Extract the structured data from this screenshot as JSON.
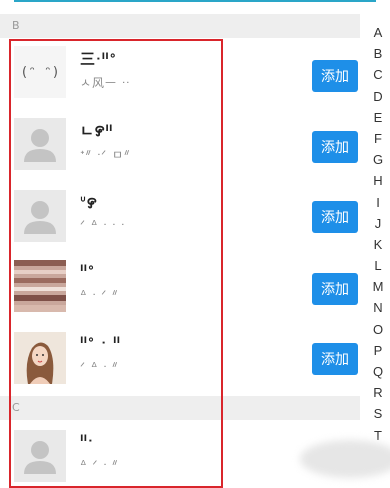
{
  "sections": {
    "b_label": "B",
    "c_label": "C"
  },
  "contacts": [
    {
      "avatar_text": "(ᵔ ᵔ)",
      "name": "三ᐧᐦᐤ",
      "subtitle": "ㅅ风ㅡ ᐧᐧ",
      "button": "添加"
    },
    {
      "name": "ㄴ꯸ᐦ",
      "subtitle": "ᐩᐥ ᐧᐟ ㅁᐥ",
      "button": "添加"
    },
    {
      "name": "ᐡ꯸",
      "subtitle": "ᐟ ᐞ ᐧ ᐧ ᐧ",
      "button": "添加"
    },
    {
      "name": "ᐦᐤ",
      "subtitle": "ᐞ ᐧ ᐟ ᐥ",
      "button": "添加"
    },
    {
      "name": "ᐦᐤ ᐧ ᐦ",
      "subtitle": "ᐟ ᐞ ᐧ ᐥ",
      "button": "添加"
    },
    {
      "name": "ᐦᐧ",
      "subtitle": "ᐞ ᐟ ᐧ ᐥ"
    }
  ],
  "index_letters": [
    "A",
    "B",
    "C",
    "D",
    "E",
    "F",
    "G",
    "H",
    "I",
    "J",
    "K",
    "L",
    "M",
    "N",
    "O",
    "P",
    "Q",
    "R",
    "S",
    "T"
  ],
  "colors": {
    "accent": "#1e8fe8",
    "highlight": "#d9252b",
    "top_line": "#2aa6c8"
  }
}
